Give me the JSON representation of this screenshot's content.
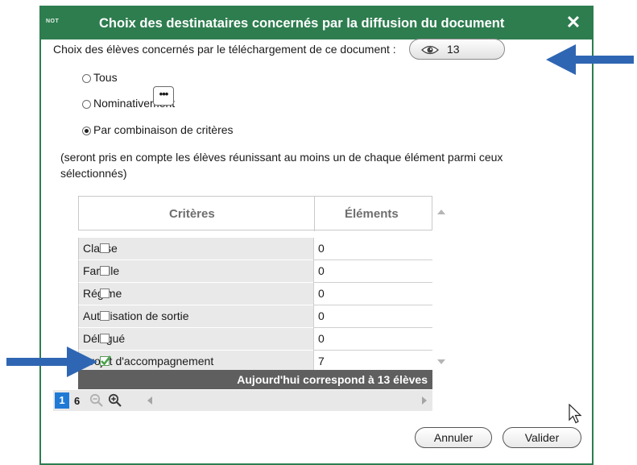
{
  "dialog": {
    "app_badge": "NOT",
    "title": "Choix des destinataires concernés par la diffusion du document",
    "close_label": "✕"
  },
  "selection": {
    "prompt": "Choix des élèves concernés par le téléchargement de ce document :",
    "count": "13",
    "options": {
      "tous": "Tous",
      "nominativement": "Nominativement",
      "combinaison": "Par combinaison de critères"
    },
    "selected": "combinaison",
    "dots_label": "•••",
    "note": "(seront pris en compte les élèves réunissant au moins un de chaque élément parmi ceux sélectionnés)"
  },
  "table": {
    "headers": {
      "criteres": "Critères",
      "elements": "Éléments"
    },
    "rows": [
      {
        "critere": "Classe",
        "elements": "0",
        "checked": false
      },
      {
        "critere": "Famille",
        "elements": "0",
        "checked": false
      },
      {
        "critere": "Régime",
        "elements": "0",
        "checked": false
      },
      {
        "critere": "Autorisation de sortie",
        "elements": "0",
        "checked": false
      },
      {
        "critere": "Délégué",
        "elements": "0",
        "checked": false
      },
      {
        "critere": "Projet d'accompagnement",
        "elements": "7",
        "checked": true
      }
    ],
    "summary": "Aujourd'hui correspond à 13 élèves"
  },
  "pager": {
    "current": "1",
    "total": "6"
  },
  "buttons": {
    "cancel": "Annuler",
    "ok": "Valider"
  },
  "colors": {
    "titlebar": "#2e7d4f",
    "arrow": "#2f66b3",
    "page_active": "#1f7ad6",
    "summary_bg": "#5f5f5f"
  }
}
